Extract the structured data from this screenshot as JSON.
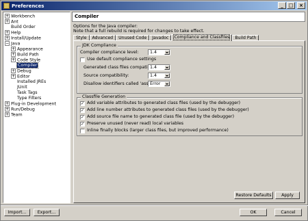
{
  "window": {
    "title": "Preferences",
    "min": "_",
    "max": "□",
    "close": "×"
  },
  "tree": {
    "items": [
      {
        "label": "Workbench",
        "exp": "+"
      },
      {
        "label": "Ant",
        "exp": "+"
      },
      {
        "label": "Build Order",
        "exp": ""
      },
      {
        "label": "Help",
        "exp": "+"
      },
      {
        "label": "Install/Update",
        "exp": "+"
      },
      {
        "label": "Java",
        "exp": "−"
      },
      {
        "label": "Appearance",
        "exp": "+"
      },
      {
        "label": "Build Path",
        "exp": "+"
      },
      {
        "label": "Code Style",
        "exp": "+"
      },
      {
        "label": "Compiler",
        "exp": ""
      },
      {
        "label": "Debug",
        "exp": "+"
      },
      {
        "label": "Editor",
        "exp": "+"
      },
      {
        "label": "Installed JREs",
        "exp": ""
      },
      {
        "label": "JUnit",
        "exp": ""
      },
      {
        "label": "Task Tags",
        "exp": ""
      },
      {
        "label": "Type Filters",
        "exp": ""
      },
      {
        "label": "Plug-in Development",
        "exp": "+"
      },
      {
        "label": "Run/Debug",
        "exp": "+"
      },
      {
        "label": "Team",
        "exp": "+"
      }
    ]
  },
  "page": {
    "title": "Compiler",
    "desc1": "Options for the Java compiler:",
    "desc2": "Note that a full rebuild is required for changes to take effect."
  },
  "tabs": [
    "Style",
    "Advanced",
    "Unused Code",
    "Javadoc",
    "Compliance and Classfiles",
    "Build Path"
  ],
  "jdk": {
    "title": "JDK Compliance",
    "compliance_label": "Compiler compliance level:",
    "compliance_value": "1.4",
    "use_default": "Use default compliance settings",
    "generated_label": "Generated class files compatibility:",
    "generated_value": "1.4",
    "source_label": "Source compatibility:",
    "source_value": "1.4",
    "assert_label": "Disallow identifiers called 'assert':",
    "assert_value": "Error"
  },
  "classfile": {
    "title": "Classfile Generation",
    "options": [
      {
        "label": "Add variable attributes to generated class files (used by the debugger)",
        "checked": "✓"
      },
      {
        "label": "Add line number attributes to generated class files (used by the debugger)",
        "checked": "✓"
      },
      {
        "label": "Add source file name to generated class file (used by the debugger)",
        "checked": "✓"
      },
      {
        "label": "Preserve unused (never read) local variables",
        "checked": "✓"
      },
      {
        "label": "Inline finally blocks (larger class files, but improved performance)",
        "checked": ""
      }
    ]
  },
  "buttons": {
    "restore": "Restore Defaults",
    "apply": "Apply",
    "import": "Import...",
    "export": "Export...",
    "ok": "OK",
    "cancel": "Cancel"
  }
}
